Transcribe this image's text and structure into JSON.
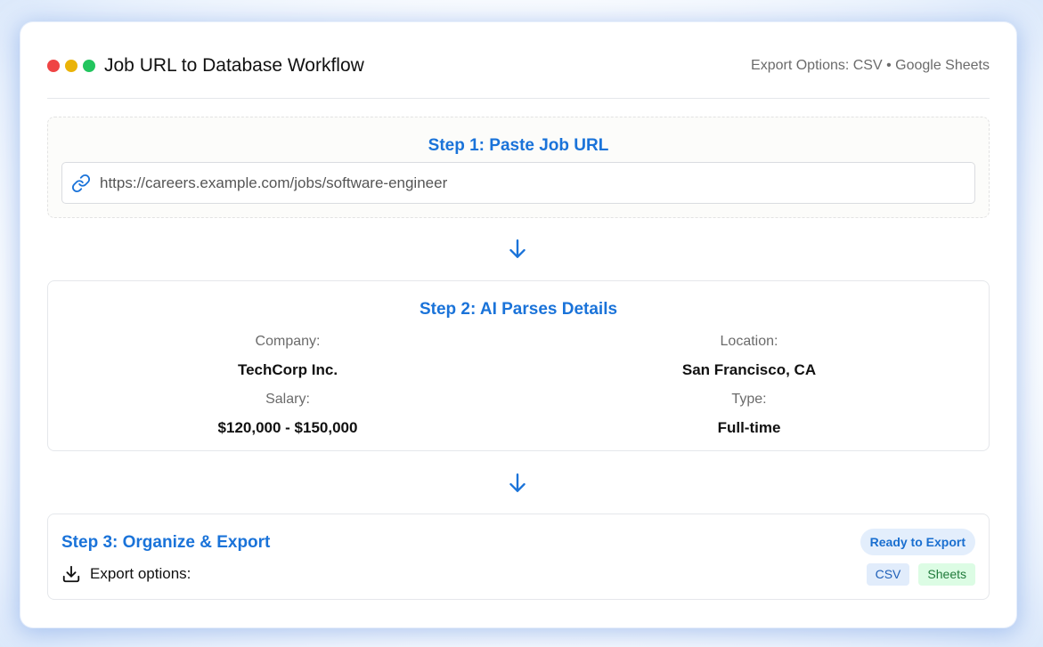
{
  "header": {
    "title": "Job URL to Database Workflow",
    "export_options": "Export Options: CSV • Google Sheets"
  },
  "step1": {
    "title": "Step 1: Paste Job URL",
    "url_value": "https://careers.example.com/jobs/software-engineer"
  },
  "step2": {
    "title": "Step 2: AI Parses Details",
    "fields": [
      {
        "label": "Company:",
        "value": "TechCorp Inc."
      },
      {
        "label": "Location:",
        "value": "San Francisco, CA"
      },
      {
        "label": "Salary:",
        "value": "$120,000 - $150,000"
      },
      {
        "label": "Type:",
        "value": "Full-time"
      }
    ]
  },
  "step3": {
    "title": "Step 3: Organize & Export",
    "status_badge": "Ready to Export",
    "export_label": "Export options:",
    "tags": [
      "CSV",
      "Sheets"
    ]
  },
  "colors": {
    "accent": "#1a73d9",
    "dot_red": "#ef4444",
    "dot_yellow": "#eab308",
    "dot_green": "#22c55e",
    "tag_csv_bg": "#e1ecfb",
    "tag_sheets_bg": "#dcfce4"
  },
  "icons": [
    "link-icon",
    "arrow-down-icon",
    "download-icon"
  ]
}
